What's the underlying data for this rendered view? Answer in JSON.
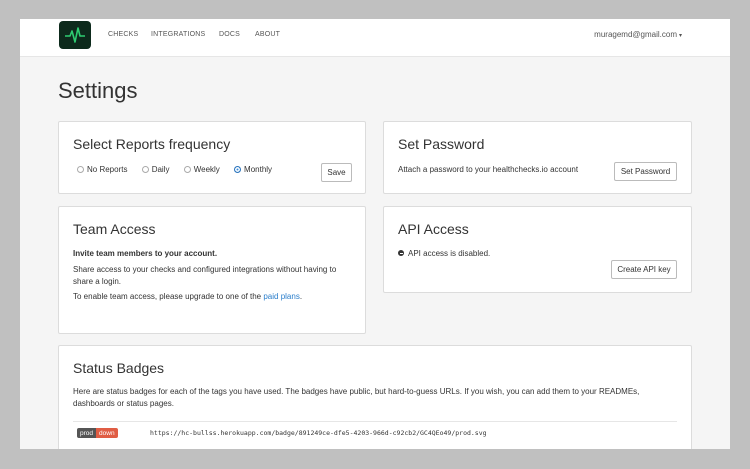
{
  "nav": {
    "links": [
      "CHECKS",
      "INTEGRATIONS",
      "DOCS",
      "ABOUT"
    ],
    "user_email": "muragemd@gmail.com",
    "user_caret": "▾"
  },
  "page_title": "Settings",
  "reports": {
    "title": "Select Reports frequency",
    "options": [
      "No Reports",
      "Daily",
      "Weekly",
      "Monthly"
    ],
    "selected": "Monthly",
    "save_label": "Save"
  },
  "password": {
    "title": "Set Password",
    "description": "Attach a password to your healthchecks.io account",
    "button_label": "Set Password"
  },
  "team": {
    "title": "Team Access",
    "intro": "Invite team members to your account.",
    "body": "Share access to your checks and configured integrations without having to share a login.",
    "upgrade_prefix": "To enable team access, please upgrade to one of the ",
    "upgrade_link": "paid plans",
    "upgrade_suffix": "."
  },
  "api": {
    "title": "API Access",
    "status": "API access is disabled.",
    "button_label": "Create API key"
  },
  "badges": {
    "title": "Status Badges",
    "description": "Here are status badges for each of the tags you have used. The badges have public, but hard-to-guess URLs. If you wish, you can add them to your READMEs, dashboards or status pages.",
    "badge_left": "prod",
    "badge_right": "down",
    "url": "https://hc-bullss.herokuapp.com/badge/891249ce-dfe5-4203-966d-c92cb2/GC4QEo49/prod.svg"
  },
  "colors": {
    "link": "#2a7ecb",
    "radio_checked": "#3a8fe0",
    "badge_down": "#e05d44",
    "logo_bg": "#0d2a1c",
    "logo_pulse": "#2ecc71"
  }
}
